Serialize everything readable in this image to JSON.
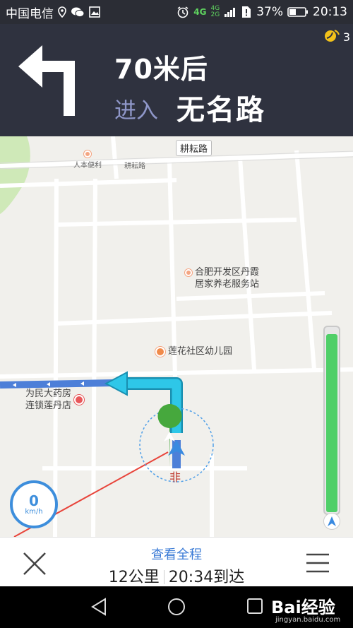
{
  "status_bar": {
    "carrier": "中国电信",
    "net_4g": "4G",
    "net_4g_small": "4G",
    "net_2g_small": "2G",
    "battery_percent": "37%",
    "time": "20:13"
  },
  "navigation": {
    "distance": "70米后",
    "enter_label": "进入",
    "road_name": "无名路",
    "gps_satellites": "3"
  },
  "map": {
    "road_label_top": "耕耘路",
    "road_label_small": "耕耘路",
    "poi_convenience": "人本便利",
    "poi_elder_care_line1": "合肥开发区丹霞",
    "poi_elder_care_line2": "居家养老服务站",
    "poi_kindergarten": "莲花社区幼儿园",
    "poi_pharmacy_line1": "为民大药房",
    "poi_pharmacy_line2": "连锁莲丹店",
    "speed_value": "0",
    "speed_unit": "km/h",
    "route_progress": 0.97
  },
  "bottom_panel": {
    "overview_label": "查看全程",
    "distance_remaining": "12公里",
    "arrival_time": "20:34到达"
  },
  "watermark": {
    "brand": "Bai经验",
    "url": "jingyan.baidu.com"
  },
  "colors": {
    "banner_bg": "#2f323f",
    "route_cyan": "#2ec7e8",
    "route_blue": "#4d7fd8",
    "accent_blue": "#3b7bd6",
    "progress_green": "#4fcf68"
  }
}
